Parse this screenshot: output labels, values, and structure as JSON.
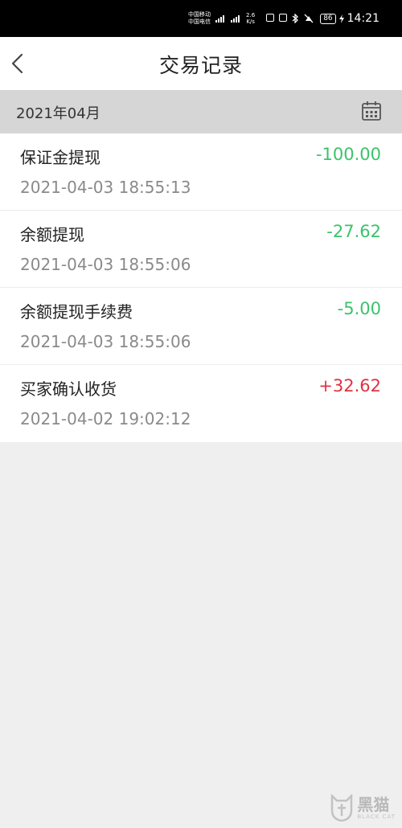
{
  "status_bar": {
    "carrier1": "中国移动",
    "carrier2": "中国电信",
    "net_speed_value": "2.6",
    "net_speed_unit": "K/s",
    "battery": "86",
    "time": "14:21"
  },
  "header": {
    "title": "交易记录"
  },
  "month_bar": {
    "month": "2021年04月"
  },
  "transactions": [
    {
      "title": "保证金提现",
      "datetime": "2021-04-03 18:55:13",
      "amount": "-100.00",
      "type": "debit"
    },
    {
      "title": "余额提现",
      "datetime": "2021-04-03 18:55:06",
      "amount": "-27.62",
      "type": "debit"
    },
    {
      "title": "余额提现手续费",
      "datetime": "2021-04-03 18:55:06",
      "amount": "-5.00",
      "type": "debit"
    },
    {
      "title": "买家确认收货",
      "datetime": "2021-04-02 19:02:12",
      "amount": "+32.62",
      "type": "credit"
    }
  ],
  "colors": {
    "debit": "#3cc36b",
    "credit": "#e0333f",
    "month_bar_bg": "#d6d6d6",
    "page_bg": "#efefef"
  },
  "watermark": {
    "text_cn": "黑猫",
    "text_en": "BLACK CAT"
  }
}
